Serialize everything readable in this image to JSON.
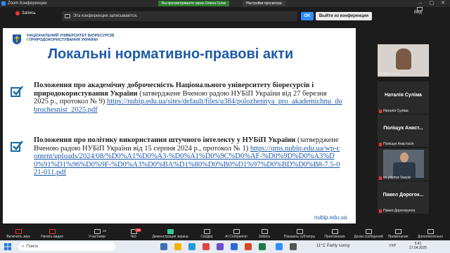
{
  "window": {
    "title": "Zoom Конференции",
    "share_pill": "Вы просматриваете экран Олена Гулак",
    "view_options": "Настройки просмотра"
  },
  "toprow": {
    "recording_label": "Запись",
    "notice": "Эта конференция записывается.",
    "ok_label": "OK",
    "leave_label": "Выйти из конференции",
    "view_label": "Вид"
  },
  "slide": {
    "uni_line1": "НАЦІОНАЛЬНИЙ УНІВЕРСИТЕТ БІОРЕСУРСІВ",
    "uni_line2": "І ПРИРОДОКОРИСТУВАННЯ УКРАЇНИ",
    "title": "Локальні нормативно-правові акти",
    "item1_bold": "Положення про академічну доброчесність Національного університету біоресурсів і природокористування України",
    "item1_text": " (затверджене Вченою радою НУБіП України від 27 березня 2025 р., протокол № 9) ",
    "item1_link": "https://nubip.edu.ua/sites/default/files/u384/polozhennya_pro_akademichnu_dobrochesnist_2025.pdf",
    "item2_bold": "Положення про політику використання штучного інтелекту у НУБіП України",
    "item2_text": " (затверджене Вченою радою НУБіП України від 15 серпня 2024 р., протокол № 1) ",
    "item2_link": "https://qms.nubip.edu.ua/wp-content/uploads/2024/08/%D0%A1%D0%A3-%D0%A1%D0%9C%D0%AF-%D0%9D%D0%A3%D0%91%D1%96%D0%9F-%D0%A3%D0%BA%D1%80%D0%B0%D1%97%D0%BD%D0%B8-7.5-021-011.pdf",
    "footer": "nubip.edu.ua"
  },
  "participants": [
    {
      "name": "Олена Гулак",
      "caption": "Олена Гулак"
    },
    {
      "name": "Наталія Суліма",
      "caption": "Наталія Суліма"
    },
    {
      "name": "Поліщук Анаст...",
      "caption": "Поліщук Анастасія"
    },
    {
      "name": "",
      "caption": "vo.ydymyr.Vasyliv"
    },
    {
      "name": "Павел Дорогок...",
      "caption": "Павел Дорогокупля"
    }
  ],
  "toolbar": {
    "audio": "Включить звук",
    "video": "Начать видео",
    "participants": "Участники",
    "participants_count": "1K",
    "chat": "Чат",
    "chat_badge": "28",
    "share": "Демонстрация экрана",
    "notes": "Сводка",
    "ai": "AI Companion",
    "record": "Запись",
    "captions": "Показать субтитры",
    "apps": "Приложения",
    "whiteboards": "Доски сообщений",
    "reactions": "Примечания",
    "more": "Дополнительно"
  },
  "taskbar": {
    "search_placeholder": "Поиск",
    "weather": "11°C  Partly sunny",
    "lang": "УКР",
    "time": "5:41",
    "date": "27.04.2025"
  }
}
